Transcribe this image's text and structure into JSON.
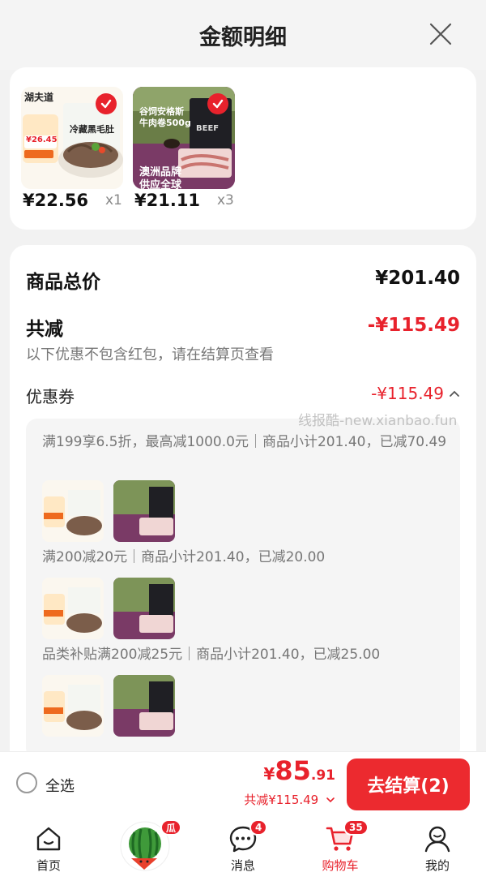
{
  "header": {
    "title": "金额明细"
  },
  "products": [
    {
      "price": "¥22.56",
      "qty": "x1",
      "brand": "湖夫道",
      "name": "冷藏黑毛肚",
      "promo_price": "¥26.45"
    },
    {
      "price": "¥21.11",
      "qty": "x3",
      "line1": "谷饲安格斯",
      "line2": "牛肉卷500g",
      "line3": "澳洲品牌",
      "line4": "供应全球",
      "pack_text": "BEEF"
    }
  ],
  "summary": {
    "total_label": "商品总价",
    "total_value": "¥201.40",
    "discount_label": "共减",
    "discount_value": "-¥115.49",
    "note": "以下优惠不包含红包，请在结算页查看",
    "coupon_label": "优惠券",
    "coupon_value": "-¥115.49"
  },
  "coupons": [
    {
      "desc": "满199享6.5折，最高减1000.0元｜商品小计201.40，已减70.49"
    },
    {
      "desc": "满200减20元｜商品小计201.40，已减20.00"
    },
    {
      "desc": "品类补贴满200减25元｜商品小计201.40，已减25.00"
    }
  ],
  "watermark": "线报酷-new.xianbao.fun",
  "checkout": {
    "select_all": "全选",
    "currency": "¥",
    "total_int": "85",
    "total_dec": ".91",
    "saved": "共减¥115.49",
    "button": "去结算(2)"
  },
  "tabbar": {
    "home": "首页",
    "melon_badge": "瓜",
    "messages": "消息",
    "messages_badge": "4",
    "cart": "购物车",
    "cart_badge": "35",
    "mine": "我的"
  },
  "colors": {
    "accent": "#e8222c",
    "background": "#f2f2f2"
  }
}
